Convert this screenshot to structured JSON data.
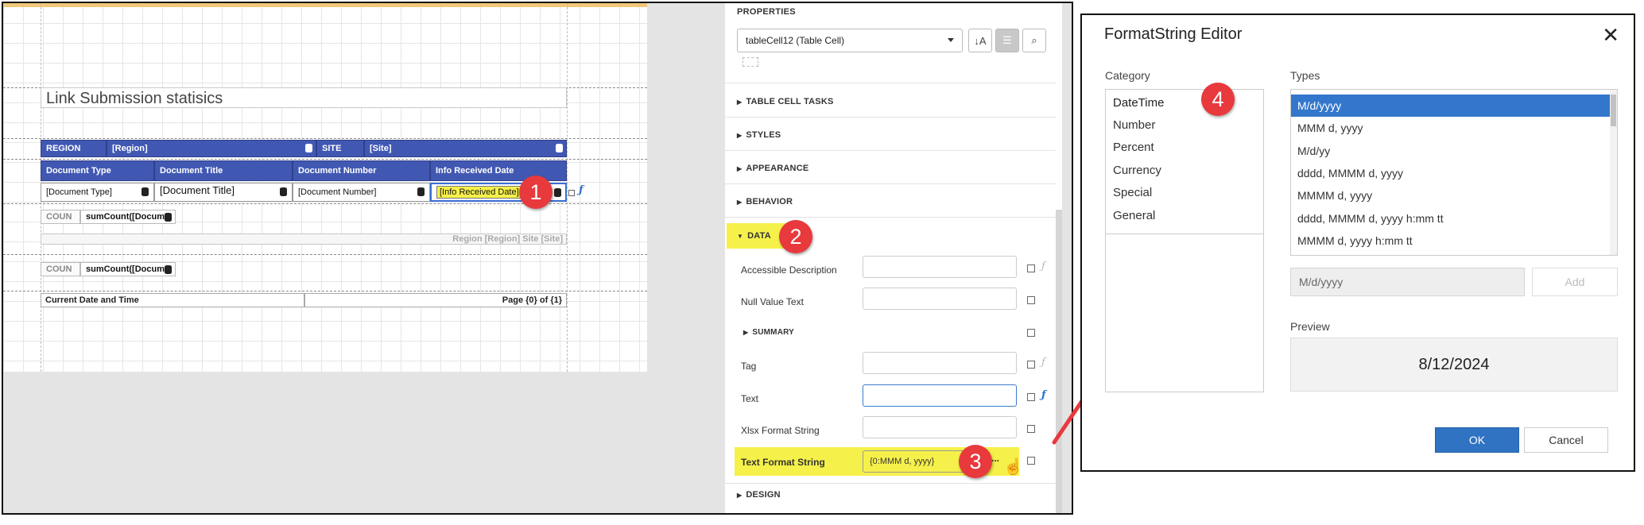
{
  "designer": {
    "report_title": "Link Submission statisics",
    "region_label": "REGION",
    "region_value": "[Region]",
    "site_label": "SITE",
    "site_value": "[Site]",
    "col_headers": [
      "Document Type",
      "Document Title",
      "Document Number",
      "Info Received Date"
    ],
    "col_values": [
      "[Document Type]",
      "[Document Title]",
      "[Document Number]",
      "[Info Received Date]"
    ],
    "count_label_1": "COUN",
    "count_value_1": "sumCount([Docum",
    "group_footer_text": "Region [Region] Site [Site]",
    "count_label_2": "COUN",
    "count_value_2": "sumCount([Docum",
    "footer_left": "Current Date and Time",
    "footer_right": "Page {0} of {1}"
  },
  "properties": {
    "title": "PROPERTIES",
    "selected_component": "tableCell12 (Table Cell)",
    "sections": {
      "table_cell_tasks": "TABLE CELL TASKS",
      "styles": "STYLES",
      "appearance": "APPEARANCE",
      "behavior": "BEHAVIOR",
      "data": "DATA",
      "summary": "SUMMARY",
      "design": "DESIGN"
    },
    "fields": {
      "accessible_description": {
        "label": "Accessible Description",
        "value": ""
      },
      "null_value_text": {
        "label": "Null Value Text",
        "value": ""
      },
      "tag": {
        "label": "Tag",
        "value": ""
      },
      "text": {
        "label": "Text",
        "value": ""
      },
      "xlsx_format_string": {
        "label": "Xlsx Format String",
        "value": ""
      },
      "text_format_string": {
        "label": "Text Format String",
        "value": "{0:MMM d, yyyy}"
      }
    },
    "ellipsis": "..."
  },
  "dialog": {
    "title": "FormatString Editor",
    "category_label": "Category",
    "categories": [
      "DateTime",
      "Number",
      "Percent",
      "Currency",
      "Special",
      "General"
    ],
    "types_label": "Types",
    "types": [
      "M/d/yyyy",
      "MMM d, yyyy",
      "M/d/yy",
      "dddd, MMMM d, yyyy",
      "MMMM d, yyyy",
      "dddd, MMMM d, yyyy h:mm tt",
      "MMMM d, yyyy h:mm tt"
    ],
    "format_value": "M/d/yyyy",
    "add_label": "Add",
    "preview_label": "Preview",
    "preview_value": "8/12/2024",
    "ok_label": "OK",
    "cancel_label": "Cancel"
  },
  "callouts": [
    "1",
    "2",
    "3",
    "4"
  ],
  "colors": {
    "header_blue": "#4158b3",
    "highlight_yellow": "#f6f14a",
    "badge_red": "#e8393d",
    "arrow_red": "#e8393d",
    "selection_blue": "#3377cc",
    "ok_blue": "#2f73c2"
  }
}
